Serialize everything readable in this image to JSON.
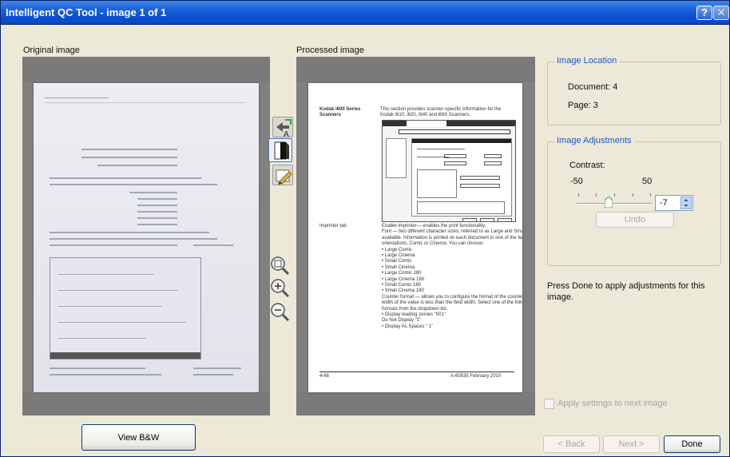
{
  "window": {
    "title": "Intelligent QC Tool - image 1 of 1"
  },
  "titlebar_buttons": {
    "help": "?",
    "close": "✕"
  },
  "panels": {
    "original_label": "Original image",
    "processed_label": "Processed image"
  },
  "processed_doc": {
    "heading": "Kodak i600 Series Scanners",
    "intro": "This section provides scanner-specific information for the Kodak i610, i620, i640 and i660 Scanners.",
    "imprinter_label": "Imprinter tab",
    "lines": [
      "Enable imprinter— enables the print functionality.",
      "Font — two different character sizes, referred to as Large and Small, are",
      "available. Information is printed on each document in one of the two",
      "orientations, Comic or Cinema. You can choose:",
      "• Large Comic",
      "• Large Cinema",
      "• Small Comic",
      "• Small Cinema",
      "• Large Comic 180",
      "• Large Cinema 180",
      "• Small Comic 180",
      "• Small Cinema 180",
      "Counter format — allows you to configure the format of the counter when the",
      "width of the value is less than the field width. Select one of the following",
      "formats from the dropdown list:",
      "• Display leading zeroes \"001\"",
      "  Do Not Display \"1\"",
      "• Display As Spaces \" 1\""
    ],
    "footer_left": "4-66",
    "footer_right": "A-60535  February 2010"
  },
  "image_location": {
    "title": "Image Location",
    "document": "Document: 4",
    "page": "Page: 3"
  },
  "image_adjustments": {
    "title": "Image Adjustments",
    "contrast_label": "Contrast:",
    "min": "-50",
    "max": "50",
    "value": "-7",
    "value_fraction": 0.43,
    "undo": "Undo"
  },
  "instruction": "Press Done to apply adjustments for this image.",
  "apply_next": "Apply settings to next image",
  "buttons": {
    "view_bw": "View B&W",
    "back": "< Back",
    "next": "Next >",
    "done": "Done"
  },
  "icons": {
    "rotate": "rotate-text-icon",
    "bw": "bw-toggle-icon",
    "edit": "edit-pencil-icon",
    "fit": "zoom-fit-icon",
    "zoom_in": "zoom-in-icon",
    "zoom_out": "zoom-out-icon"
  }
}
